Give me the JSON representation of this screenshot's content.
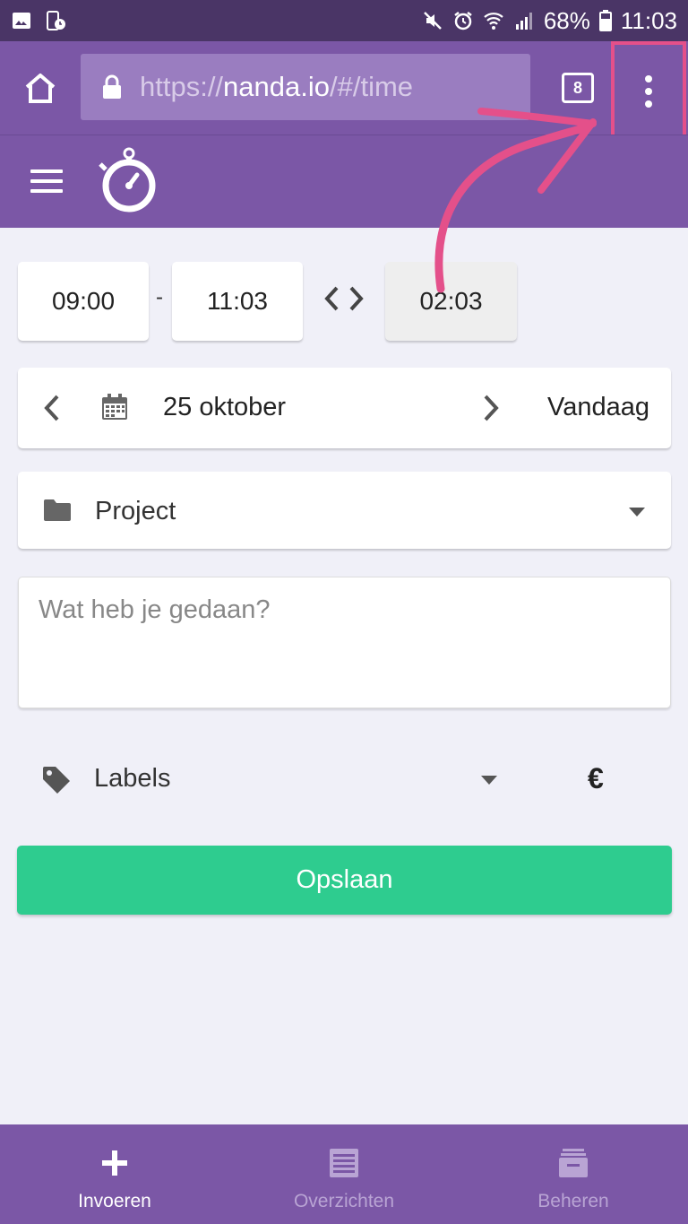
{
  "status_bar": {
    "battery": "68%",
    "time": "11:03"
  },
  "browser": {
    "url_prefix": "https://",
    "url_host": "nanda.io",
    "url_path": "/#/time",
    "tab_count": "8"
  },
  "time": {
    "start": "09:00",
    "separator": "-",
    "end": "11:03",
    "duration": "02:03"
  },
  "date": {
    "label": "25 oktober",
    "today_label": "Vandaag"
  },
  "project": {
    "label": "Project"
  },
  "description": {
    "placeholder": "Wat heb je gedaan?"
  },
  "labels": {
    "label": "Labels",
    "currency": "€"
  },
  "save_button": {
    "label": "Opslaan"
  },
  "bottom_nav": {
    "items": [
      {
        "label": "Invoeren",
        "icon": "plus-icon",
        "active": true
      },
      {
        "label": "Overzichten",
        "icon": "list-icon",
        "active": false
      },
      {
        "label": "Beheren",
        "icon": "archive-icon",
        "active": false
      }
    ]
  },
  "colors": {
    "primary": "#7b57a6",
    "status_bar": "#4a3566",
    "accent_green": "#2ecc8f",
    "highlight_pink": "#e4508a"
  }
}
